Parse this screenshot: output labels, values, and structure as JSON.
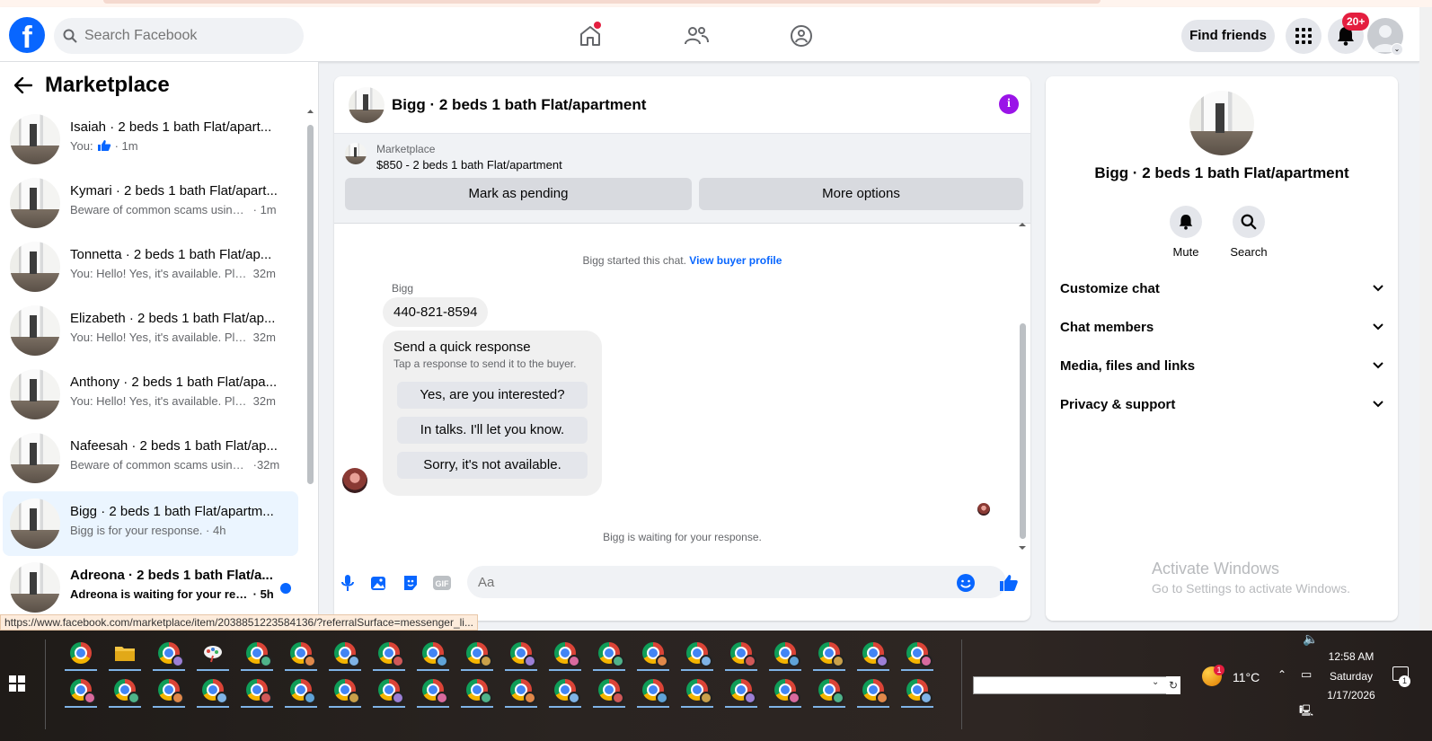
{
  "header": {
    "logo": "f",
    "search_placeholder": "Search Facebook",
    "find_friends": "Find friends",
    "notif_count": "20+"
  },
  "sidebar": {
    "title": "Marketplace",
    "conversations": [
      {
        "name": "Isaiah · 2 beds 1 bath Flat/apart...",
        "preview": "You:",
        "time": "· 1m",
        "thumb_icon": "like-icon"
      },
      {
        "name": "Kymari · 2 beds 1 bath Flat/apart...",
        "preview": "Beware of common scams using p...",
        "time": "· 1m"
      },
      {
        "name": "Tonnetta · 2 beds 1 bath Flat/ap...",
        "preview": "You: Hello! Yes, it's available. Plea...",
        "time": "32m"
      },
      {
        "name": "Elizabeth · 2 beds 1 bath Flat/ap...",
        "preview": "You: Hello! Yes, it's available. Plea...",
        "time": "32m"
      },
      {
        "name": "Anthony · 2 beds 1 bath Flat/apa...",
        "preview": "You: Hello! Yes, it's available. Plea...",
        "time": "32m"
      },
      {
        "name": "Nafeesah · 2 beds 1 bath Flat/ap...",
        "preview": "Beware of common scams using ...",
        "time": "·32m"
      },
      {
        "name": "Bigg · 2 beds 1 bath Flat/apartm...",
        "preview": "Bigg is for your response.",
        "time": "· 4h"
      },
      {
        "name": "Adreona · 2 beds 1 bath Flat/a...",
        "preview": "Adreona is waiting for your resp...",
        "time": "· 5h"
      }
    ]
  },
  "chat": {
    "title": "Bigg · 2 beds 1 bath Flat/apartment",
    "listing_source": "Marketplace",
    "listing_price": "$850 - 2 beds 1 bath Flat/apartment",
    "mark_pending": "Mark as pending",
    "more_options": "More options",
    "started_text": "Bigg started this chat.",
    "view_buyer_profile": "View buyer profile",
    "sender_name": "Bigg",
    "phone_message": "440-821-8594",
    "quick_title": "Send a quick response",
    "quick_subtitle": "Tap a response to send it to the buyer.",
    "quick_responses": [
      "Yes, are you interested?",
      "In talks. I'll let you know.",
      "Sorry, it's not available."
    ],
    "waiting_text": "Bigg is waiting for your response.",
    "input_placeholder": "Aa"
  },
  "details": {
    "title": "Bigg · 2 beds 1 bath Flat/apartment",
    "mute": "Mute",
    "search": "Search",
    "sections": [
      "Customize chat",
      "Chat members",
      "Media, files and links",
      "Privacy & support"
    ],
    "activate_title": "Activate Windows",
    "activate_sub": "Go to Settings to activate Windows."
  },
  "status_url": "https://www.facebook.com/marketplace/item/2038851223584136/?referralSurface=messenger_li...",
  "taskbar": {
    "temperature": "11°C",
    "weather_badge": "1",
    "time": "12:58 AM",
    "day": "Saturday",
    "date": "1/17/2026",
    "notification_count": "1"
  },
  "colors": {
    "brand_blue": "#0866ff",
    "badge_red": "#e41e3f",
    "info_purple": "#9a14e8",
    "active_row": "#ebf5ff"
  }
}
